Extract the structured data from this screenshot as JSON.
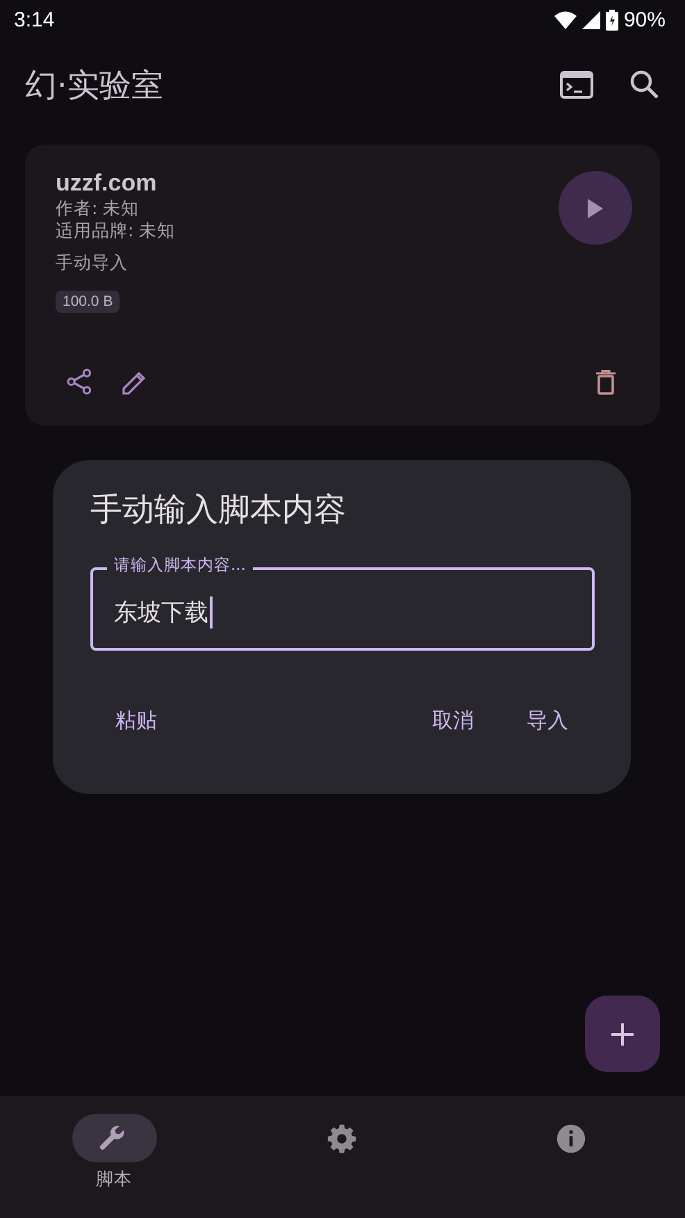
{
  "status_bar": {
    "time": "3:14",
    "battery": "90%"
  },
  "app_bar": {
    "title": "幻·实验室"
  },
  "script_card": {
    "title": "uzzf.com",
    "author": "作者: 未知",
    "brand": "适用品牌: 未知",
    "source": "手动导入",
    "size": "100.0 B"
  },
  "dialog": {
    "title": "手动输入脚本内容",
    "field": {
      "label": "请输入脚本内容...",
      "value": "东坡下载"
    },
    "buttons": [
      {
        "label": "粘贴",
        "kind": "left"
      },
      {
        "label": "取消",
        "kind": "right"
      },
      {
        "label": "导入",
        "kind": "right"
      }
    ]
  },
  "bottom_nav": [
    {
      "kind": "wrench",
      "label": "脚本",
      "selected": true
    },
    {
      "kind": "gear",
      "selected": false
    },
    {
      "kind": "info",
      "selected": false
    }
  ]
}
